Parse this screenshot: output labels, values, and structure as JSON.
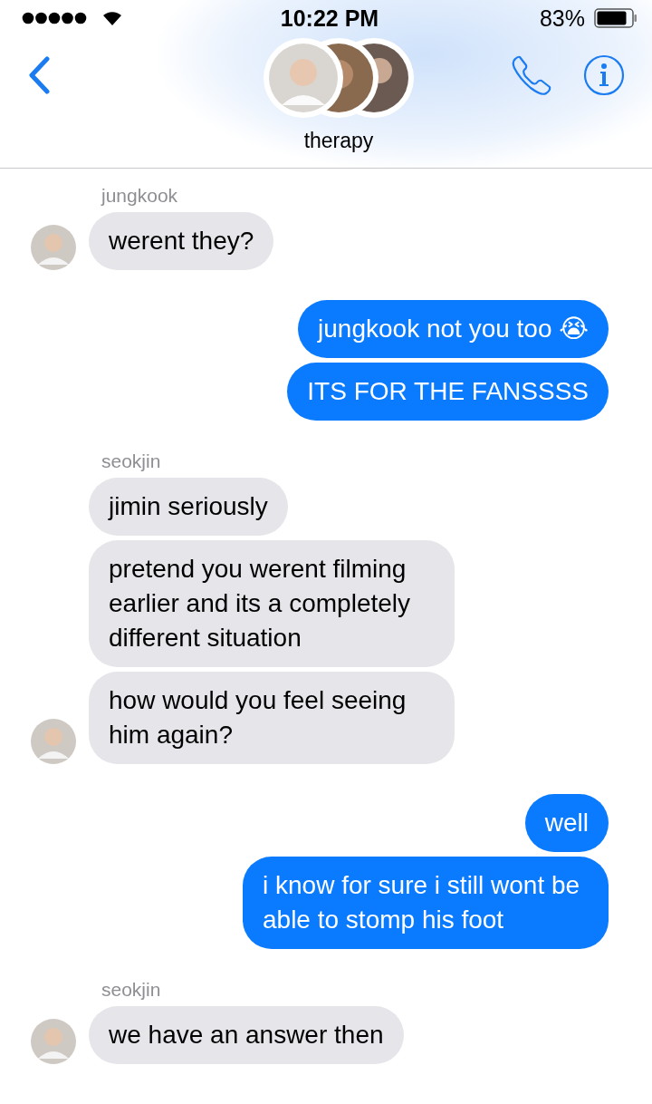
{
  "status_bar": {
    "time": "10:22 PM",
    "battery": "83%"
  },
  "header": {
    "title": "therapy"
  },
  "messages": [
    {
      "kind": "incoming",
      "sender": "jungkook",
      "avatar": true,
      "text": "werent they?"
    },
    {
      "kind": "outgoing",
      "text": "jungkook not you too 😭"
    },
    {
      "kind": "outgoing",
      "text": "ITS FOR THE FANSSSS"
    },
    {
      "kind": "incoming",
      "sender": "seokjin",
      "avatar": false,
      "text": "jimin seriously"
    },
    {
      "kind": "incoming",
      "avatar": false,
      "text": "pretend you werent filming earlier and its a completely different situation"
    },
    {
      "kind": "incoming",
      "avatar": true,
      "text": "how would you feel seeing him again?"
    },
    {
      "kind": "outgoing",
      "text": "well"
    },
    {
      "kind": "outgoing",
      "text": "i know for sure i still wont be able to stomp his foot"
    },
    {
      "kind": "incoming",
      "sender": "seokjin",
      "avatar": true,
      "text": "we have an answer then"
    }
  ]
}
